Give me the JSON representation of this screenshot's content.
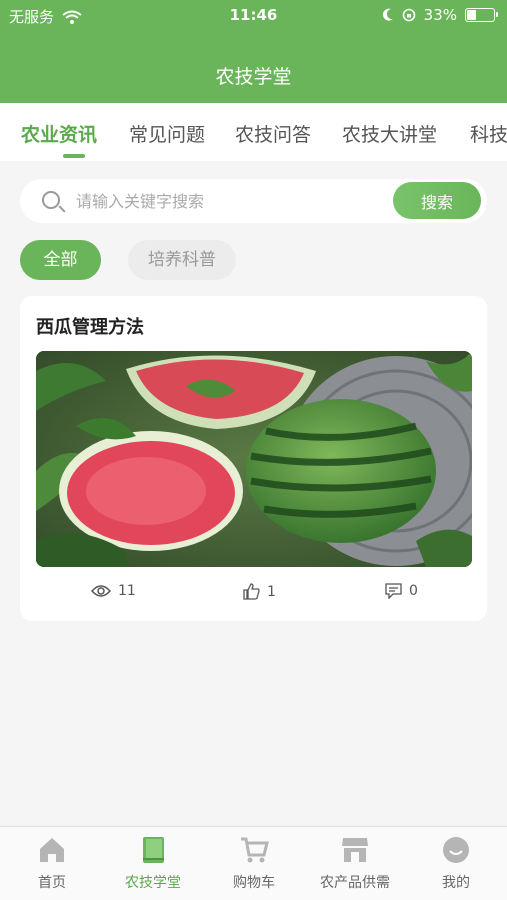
{
  "status_bar": {
    "carrier": "无服务",
    "time": "11:46",
    "battery": "33%",
    "battery_level": 0.33
  },
  "header": {
    "title": "农技学堂"
  },
  "tabs": [
    {
      "label": "农业资讯"
    },
    {
      "label": "常见问题"
    },
    {
      "label": "农技问答"
    },
    {
      "label": "农技大讲堂"
    },
    {
      "label": "科技"
    }
  ],
  "search": {
    "placeholder": "请输入关键字搜索",
    "button_label": "搜索"
  },
  "filters": [
    {
      "label": "全部"
    },
    {
      "label": "培养科普"
    }
  ],
  "article": {
    "title": "西瓜管理方法",
    "views": "11",
    "likes": "1",
    "comments": "0"
  },
  "tabbar": [
    {
      "label": "首页",
      "icon": "home-icon"
    },
    {
      "label": "农技学堂",
      "icon": "book-icon"
    },
    {
      "label": "购物车",
      "icon": "cart-icon"
    },
    {
      "label": "农产品供需",
      "icon": "store-icon"
    },
    {
      "label": "我的",
      "icon": "profile-icon"
    }
  ],
  "colors": {
    "brand": "#6ab55a",
    "active_text": "#5aaa4a"
  }
}
